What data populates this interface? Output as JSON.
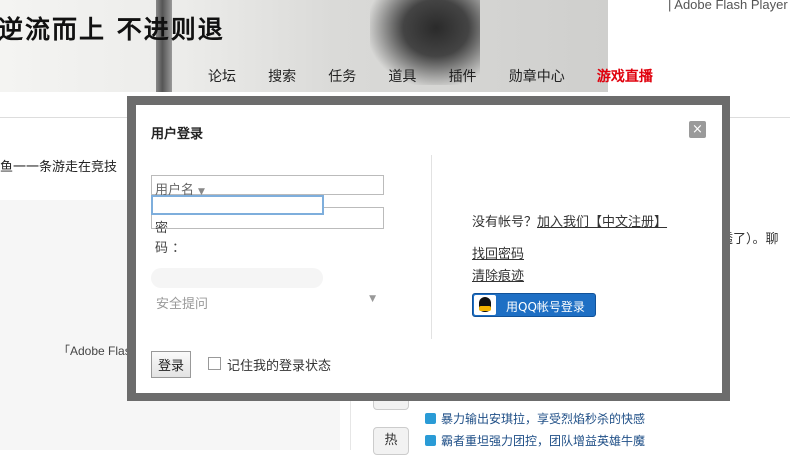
{
  "header": {
    "calligraphy_line": "逆流而上  不进则退",
    "flash_notice": "| Adobe Flash Player",
    "nav": [
      "论坛",
      "搜索",
      "任务",
      "道具",
      "插件",
      "勋章中心",
      "游戏直播"
    ]
  },
  "page": {
    "marquee": "鱼一一条游走在竞技",
    "flash_left": "「Adobe Flas",
    "right_text": "透了）。聊",
    "hot_label": "热",
    "news": [
      "暴力输出安琪拉，享受烈焰秒杀的快感",
      "霸者重坦强力团控，团队增益英雄牛魔"
    ]
  },
  "dialog": {
    "title": "用户登录",
    "close": "×",
    "username_label": "用户名",
    "password_label_1": "密",
    "password_label_2": "码  ：",
    "security_question": "安全提问",
    "no_account": "没有帐号？",
    "register_link": "加入我们【中文注册】",
    "forgot_password": "找回密码",
    "clear_traces": "清除痕迹",
    "qq_login": "用QQ帐号登录",
    "login_button": "登录",
    "remember_me": "记住我的登录状态"
  }
}
